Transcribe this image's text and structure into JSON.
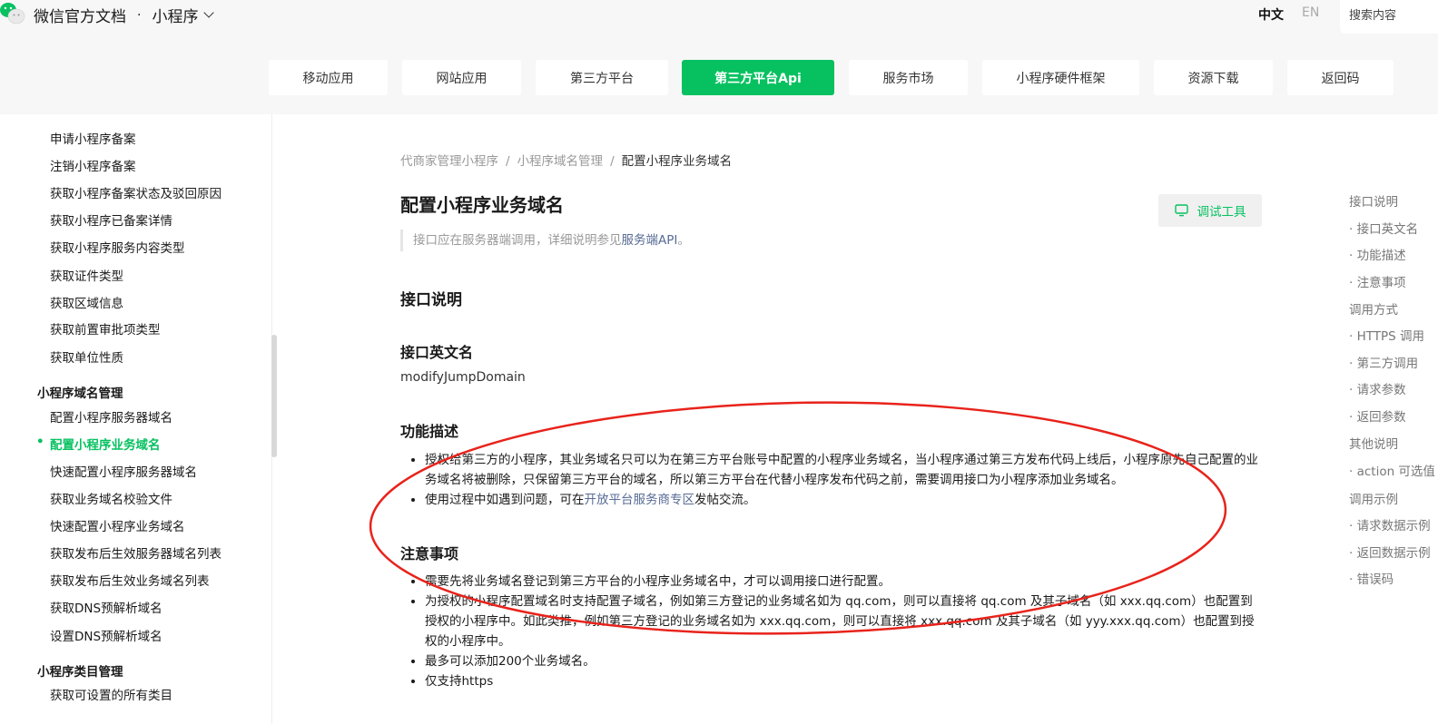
{
  "header": {
    "brand": "微信官方文档",
    "section": "小程序",
    "dot": "·",
    "lang_zh": "中文",
    "lang_en": "EN",
    "search_placeholder": "搜索内容"
  },
  "nav": [
    "移动应用",
    "网站应用",
    "第三方平台",
    "第三方平台Api",
    "服务市场",
    "小程序硬件框架",
    "资源下载",
    "返回码"
  ],
  "sidebar": {
    "items_a": [
      "申请小程序备案",
      "注销小程序备案",
      "获取小程序备案状态及驳回原因",
      "获取小程序已备案详情",
      "获取小程序服务内容类型",
      "获取证件类型",
      "获取区域信息",
      "获取前置审批项类型",
      "获取单位性质"
    ],
    "group_domain": "小程序域名管理",
    "items_b": [
      "配置小程序服务器域名",
      "配置小程序业务域名",
      "快速配置小程序服务器域名",
      "获取业务域名校验文件",
      "快速配置小程序业务域名",
      "获取发布后生效服务器域名列表",
      "获取发布后生效业务域名列表",
      "获取DNS预解析域名",
      "设置DNS预解析域名"
    ],
    "group_category": "小程序类目管理",
    "items_c": [
      "获取可设置的所有类目"
    ]
  },
  "breadcrumb": [
    "代商家管理小程序",
    "小程序域名管理",
    "配置小程序业务域名"
  ],
  "breadcrumb_sep": "/",
  "page": {
    "title": "配置小程序业务域名",
    "debug_label": "调试工具",
    "note_text": "接口应在服务器端调用，详细说明参见",
    "note_link": "服务端API",
    "note_end": "。",
    "h_desc": "接口说明",
    "h_en": "接口英文名",
    "api_name": "modifyJumpDomain",
    "h_func": "功能描述",
    "func_1": "授权给第三方的小程序，其业务域名只可以为在第三方平台账号中配置的小程序业务域名，当小程序通过第三方发布代码上线后，小程序原先自己配置的业务域名将被删除，只保留第三方平台的域名，所以第三方平台在代替小程序发布代码之前，需要调用接口为小程序添加业务域名。",
    "func_2_pre": "使用过程中如遇到问题，可在",
    "func_2_link": "开放平台服务商专区",
    "func_2_post": "发帖交流。",
    "h_notice": "注意事项",
    "notice": [
      "需要先将业务域名登记到第三方平台的小程序业务域名中，才可以调用接口进行配置。",
      "为授权的小程序配置域名时支持配置子域名，例如第三方登记的业务域名如为 qq.com，则可以直接将 qq.com 及其子域名（如 xxx.qq.com）也配置到授权的小程序中。如此类推，例如第三方登记的业务域名如为 xxx.qq.com，则可以直接将 xxx.qq.com 及其子域名（如 yyy.xxx.qq.com）也配置到授权的小程序中。",
      "最多可以添加200个业务域名。",
      "仅支持https"
    ]
  },
  "toc": [
    "接口说明",
    "· 接口英文名",
    "· 功能描述",
    "· 注意事项",
    "调用方式",
    "· HTTPS 调用",
    "· 第三方调用",
    "· 请求参数",
    "· 返回参数",
    "其他说明",
    "· action 可选值",
    "调用示例",
    "· 请求数据示例",
    "· 返回数据示例",
    "· 错误码"
  ],
  "colors": {
    "brand_green": "#07c160",
    "link": "#576b95",
    "annotation_red": "#e8231b"
  }
}
